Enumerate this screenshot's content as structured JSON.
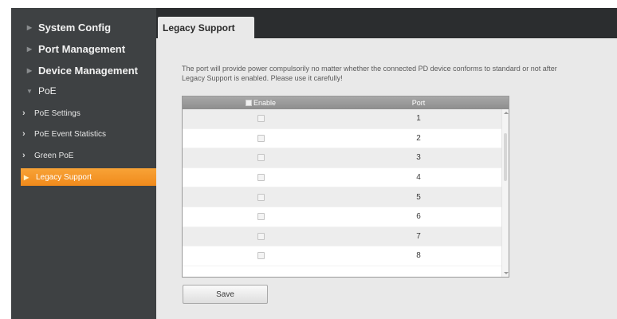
{
  "sidebar": {
    "items": [
      {
        "label": "System Config"
      },
      {
        "label": "Port Management"
      },
      {
        "label": "Device Management"
      },
      {
        "label": "PoE"
      }
    ],
    "poe_subitems": [
      {
        "label": "PoE Settings"
      },
      {
        "label": "PoE Event Statistics"
      },
      {
        "label": "Green PoE"
      },
      {
        "label": "Legacy Support"
      }
    ]
  },
  "main": {
    "tab_label": "Legacy Support",
    "notice": "The port will provide power compulsorily no matter whether the connected PD device conforms to standard or not after Legacy Support is enabled. Please use it carefully!",
    "table": {
      "header_enable": "Enable",
      "header_port": "Port",
      "rows": [
        {
          "port": "1",
          "enabled": false
        },
        {
          "port": "2",
          "enabled": false
        },
        {
          "port": "3",
          "enabled": false
        },
        {
          "port": "4",
          "enabled": false
        },
        {
          "port": "5",
          "enabled": false
        },
        {
          "port": "6",
          "enabled": false
        },
        {
          "port": "7",
          "enabled": false
        },
        {
          "port": "8",
          "enabled": false
        }
      ]
    },
    "save_label": "Save"
  },
  "colors": {
    "sidebar_bg": "#3e4143",
    "active_item": "#f39322",
    "tabbar_bg": "#2b2d2f",
    "content_bg": "#e9e9e9"
  },
  "icons": {
    "collapsed_arrow": "triangle-right-icon",
    "expanded_arrow": "triangle-down-icon",
    "subitem_chevron": "chevron-right-icon"
  }
}
